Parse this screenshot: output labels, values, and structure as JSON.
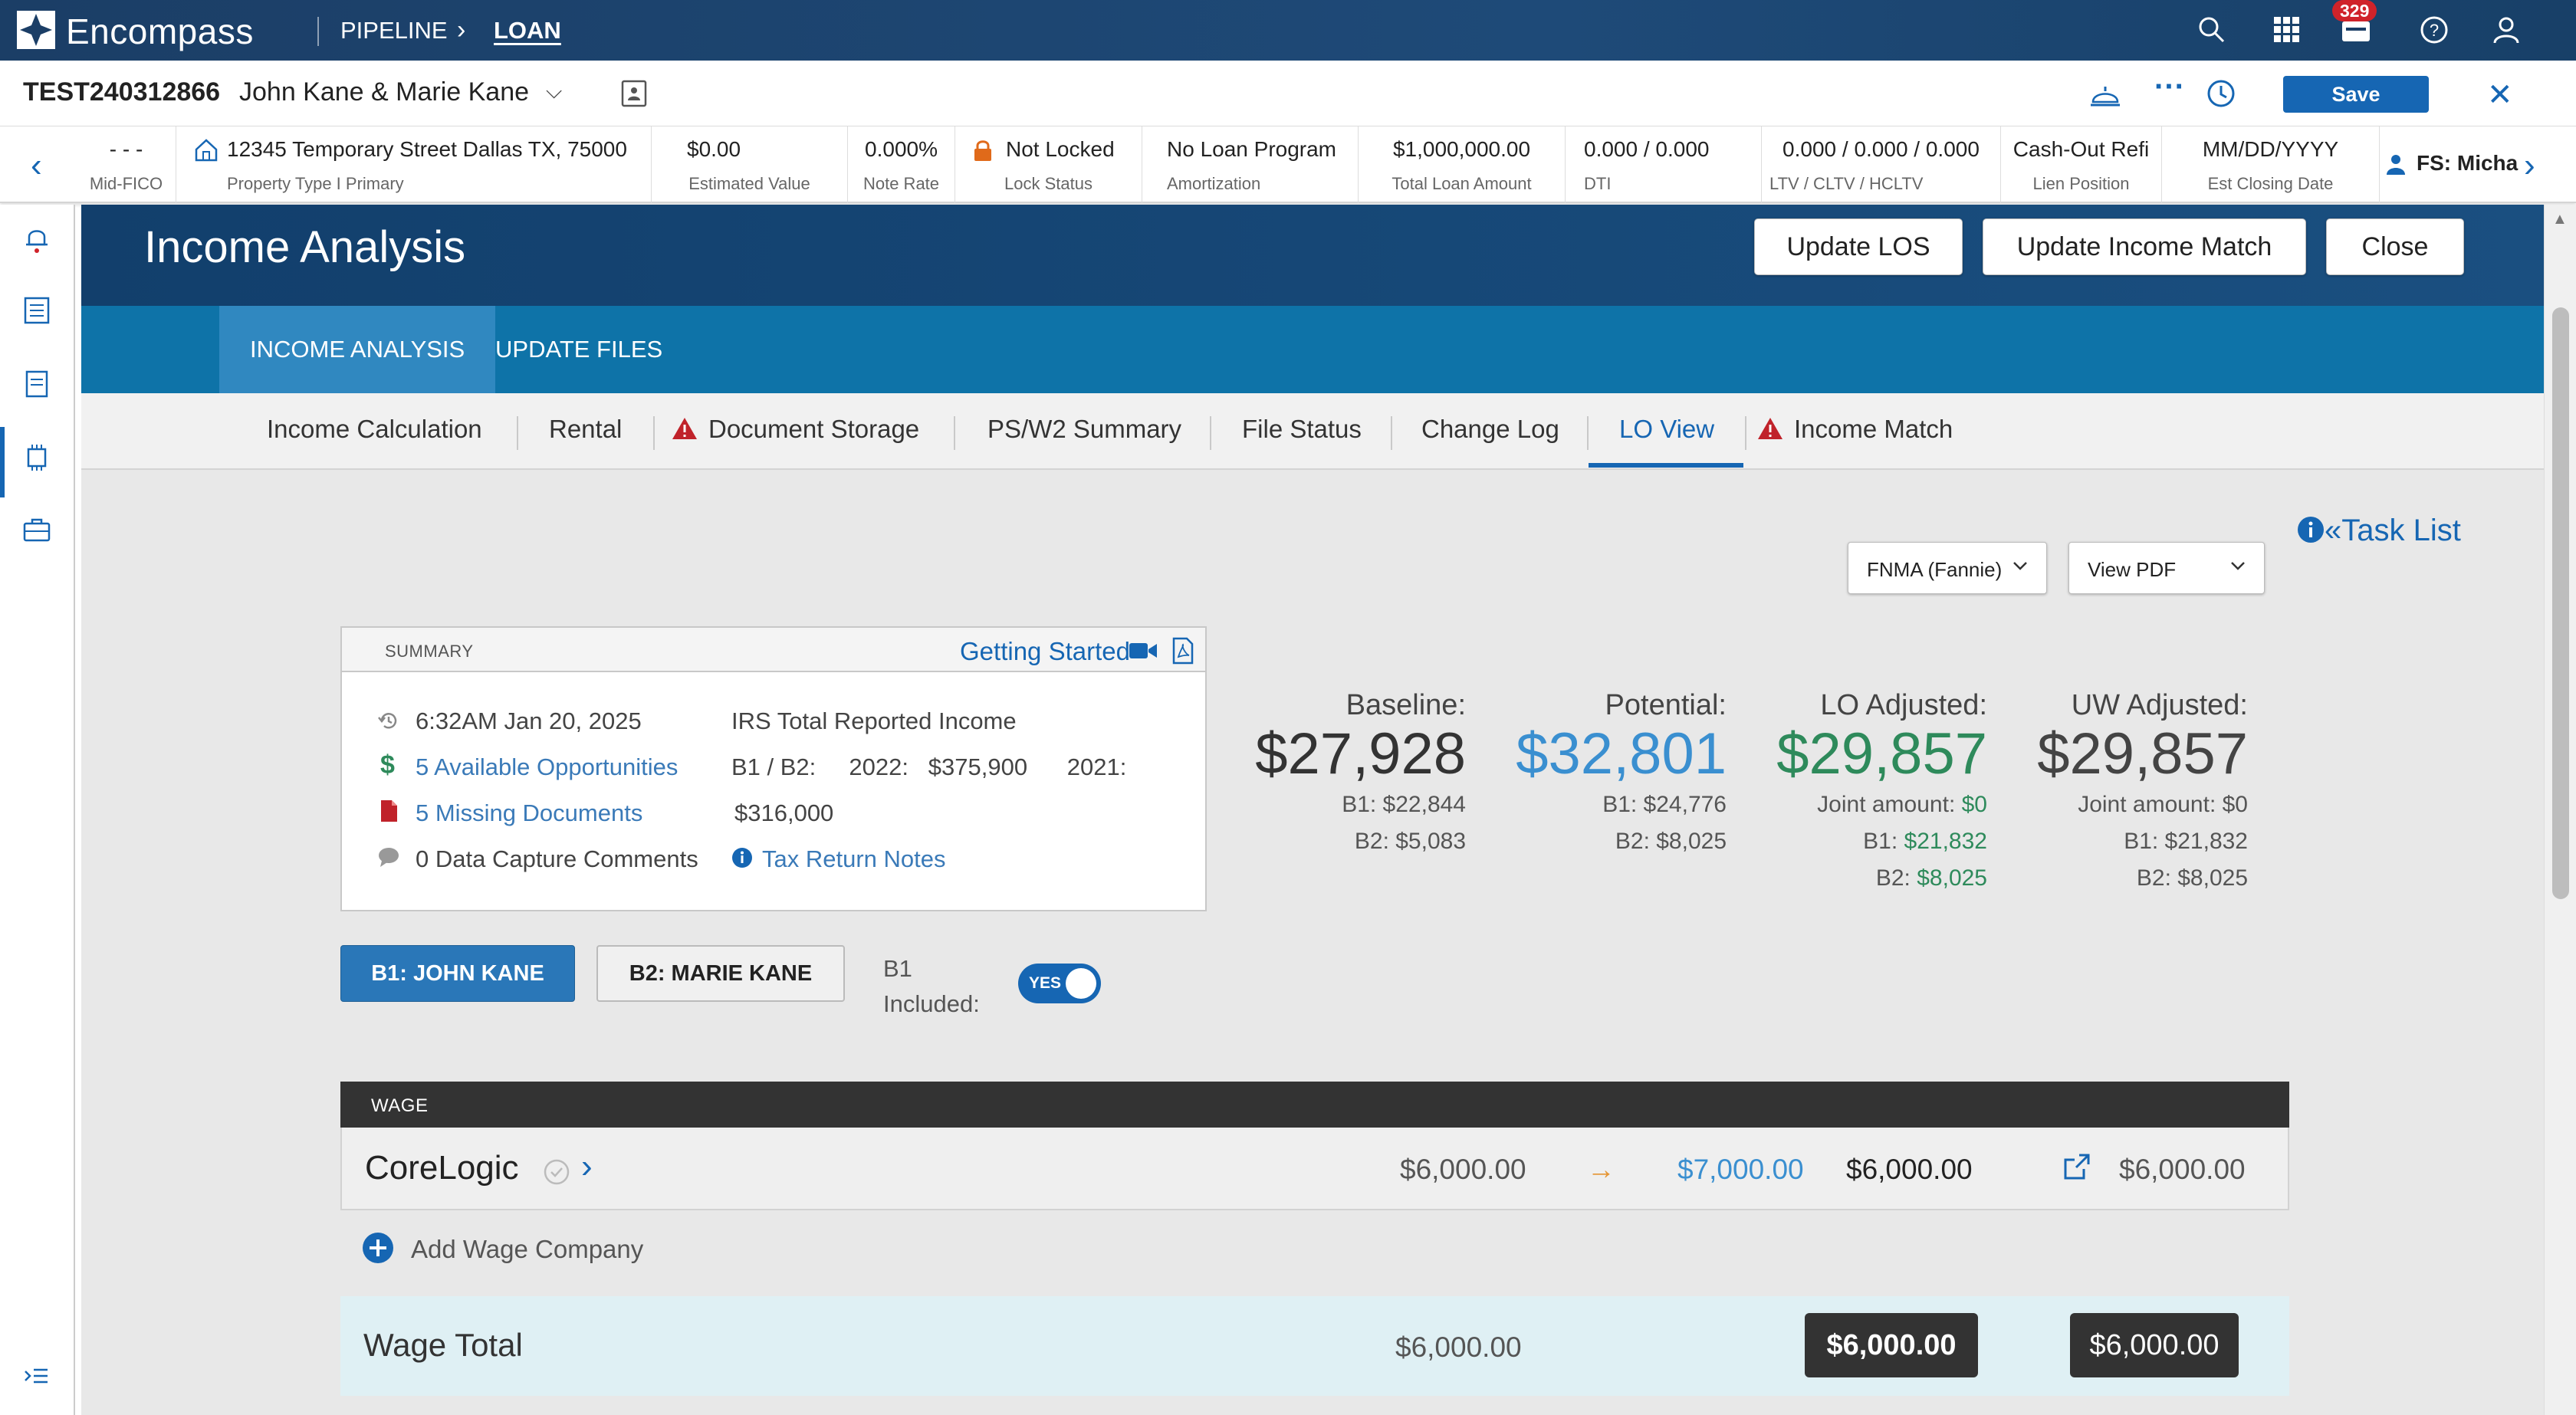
{
  "app": {
    "brand": "Encompass",
    "nav": {
      "pipeline": "PIPELINE",
      "loan": "LOAN"
    },
    "notification_count": "329",
    "icons": [
      "search-icon",
      "apps-grid-icon",
      "inbox-icon",
      "help-icon",
      "user-icon"
    ]
  },
  "loan": {
    "id": "TEST240312866",
    "borrowers": "John Kane & Marie Kane",
    "save_label": "Save"
  },
  "strip": [
    {
      "value": "- - -",
      "label": "Mid-FICO"
    },
    {
      "value": "12345 Temporary Street Dallas TX, 75000",
      "label": "Property Type I Primary"
    },
    {
      "value": "$0.00",
      "label": "Estimated Value"
    },
    {
      "value": "0.000%",
      "label": "Note Rate"
    },
    {
      "value": "Not Locked",
      "label": "Lock Status"
    },
    {
      "value": "No Loan Program",
      "label": "Amortization"
    },
    {
      "value": "$1,000,000.00",
      "label": "Total Loan Amount"
    },
    {
      "value": "0.000 / 0.000",
      "label": "DTI"
    },
    {
      "value": "0.000 / 0.000 / 0.000",
      "label": "LTV / CLTV / HCLTV"
    },
    {
      "value": "Cash-Out Refi",
      "label": "Lien Position"
    },
    {
      "value": "MM/DD/YYYY",
      "label": "Est Closing Date"
    },
    {
      "value": "FS: Micha",
      "label": ""
    }
  ],
  "panel": {
    "title": "Income Analysis",
    "buttons": {
      "update_los": "Update LOS",
      "update_income_match": "Update Income Match",
      "close": "Close"
    },
    "tabs": [
      "INCOME ANALYSIS",
      "UPDATE FILES"
    ],
    "subtabs": [
      "Income Calculation",
      "Rental",
      "Document Storage",
      "PS/W2 Summary",
      "File Status",
      "Change Log",
      "LO View",
      "Income Match"
    ],
    "active_subtab": "LO View",
    "task_list": "Task List",
    "agency_select": "FNMA (Fannie)",
    "pdf_select": "View PDF"
  },
  "summary": {
    "header": "SUMMARY",
    "getting_started": "Getting Started",
    "timestamp": "6:32AM Jan 20, 2025",
    "opportunities": "5 Available Opportunities",
    "missing_docs": "5 Missing Documents",
    "comments": "0 Data Capture Comments",
    "irs_title": "IRS Total Reported Income",
    "irs_line1": "B1 / B2:     2022:   $375,900      2021:",
    "irs_line2": "$316,000",
    "tax_notes": "Tax Return Notes"
  },
  "totals": {
    "baseline": {
      "label": "Baseline:",
      "value": "$27,928",
      "b1": "B1:  $22,844",
      "b2": "B2:  $5,083"
    },
    "potential": {
      "label": "Potential:",
      "value": "$32,801",
      "b1": "B1:  $24,776",
      "b2": "B2:  $8,025"
    },
    "lo_adjusted": {
      "label": "LO Adjusted:",
      "value": "$29,857",
      "joint_label": "Joint amount:",
      "joint": "$0",
      "b1_label": "B1:",
      "b1": "$21,832",
      "b2_label": "B2:",
      "b2": "$8,025"
    },
    "uw_adjusted": {
      "label": "UW Adjusted:",
      "value": "$29,857",
      "joint": "Joint amount:  $0",
      "b1": "B1:  $21,832",
      "b2": "B2:  $8,025"
    }
  },
  "borrower_tabs": {
    "b1": "B1: JOHN KANE",
    "b2": "B2: MARIE KANE",
    "included_label_1": "B1",
    "included_label_2": "Included:",
    "toggle": "YES"
  },
  "wage": {
    "header": "WAGE",
    "row": {
      "company": "CoreLogic",
      "baseline": "$6,000.00",
      "potential": "$7,000.00",
      "lo": "$6,000.00",
      "uw": "$6,000.00"
    },
    "add_label": "Add Wage Company",
    "total_label": "Wage Total",
    "total_baseline": "$6,000.00",
    "total_lo": "$6,000.00",
    "total_uw": "$6,000.00"
  },
  "colors": {
    "brand_navy": "#1b3e66",
    "tab_blue": "#0e73a8",
    "link_blue": "#1666b3",
    "green": "#2e8a5b",
    "potential_blue": "#3a8fd0"
  }
}
